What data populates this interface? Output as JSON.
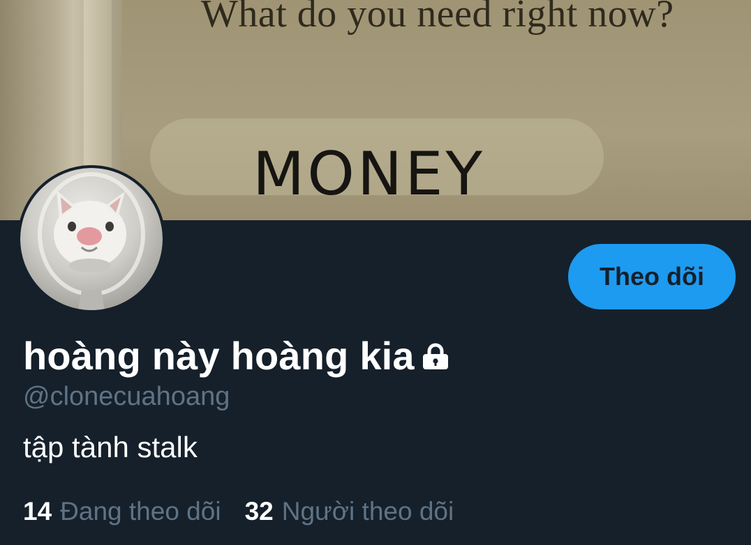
{
  "banner": {
    "question_text": "What do you need right now?",
    "answer_text": "MONEY"
  },
  "profile": {
    "display_name": "hoàng này hoàng kia",
    "protected_icon": "lock-icon",
    "handle": "@clonecuahoang",
    "bio": "tập tành stalk"
  },
  "actions": {
    "follow_label": "Theo dõi"
  },
  "stats": {
    "following_count": "14",
    "following_label": "Đang theo dõi",
    "followers_count": "32",
    "followers_label": "Người theo dõi"
  },
  "colors": {
    "background": "#15202b",
    "accent": "#1d9bf0",
    "secondary_text": "#5f7384",
    "primary_text": "#ffffff"
  }
}
